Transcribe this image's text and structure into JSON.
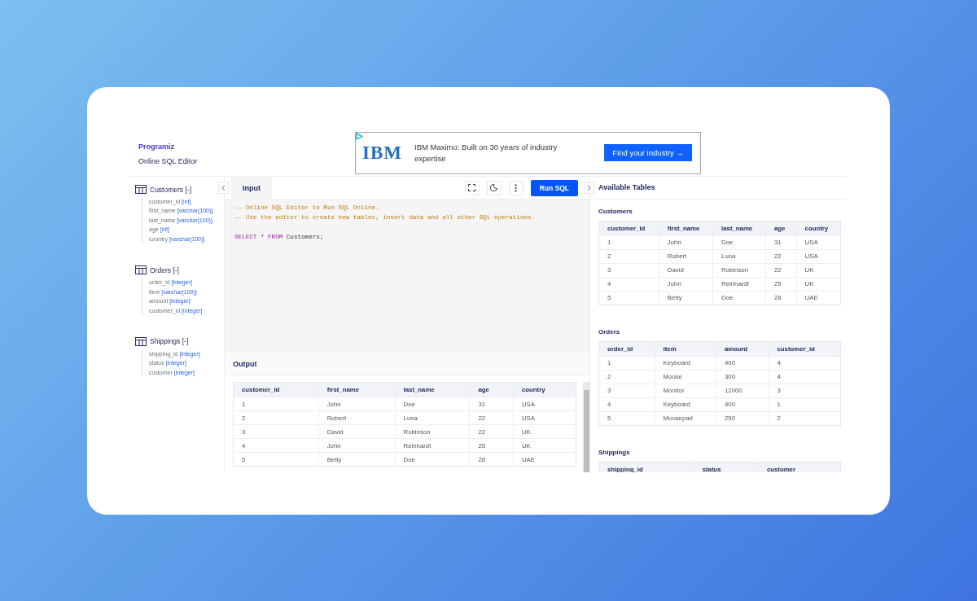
{
  "header": {
    "logo": "Programiz",
    "subtitle": "Online SQL Editor"
  },
  "ad": {
    "brand": "IBM",
    "text": "IBM Maximo: Built on 30 years of industry expertise",
    "button": "Find your industry →"
  },
  "schema": [
    {
      "name": "Customers",
      "toggle": "[-]",
      "columns": [
        {
          "name": "customer_id",
          "type": "[int]"
        },
        {
          "name": "first_name",
          "type": "[varchar(100)]"
        },
        {
          "name": "last_name",
          "type": "[varchar(100)]"
        },
        {
          "name": "age",
          "type": "[int]"
        },
        {
          "name": "country",
          "type": "[varchar(100)]"
        }
      ]
    },
    {
      "name": "Orders",
      "toggle": "[-]",
      "columns": [
        {
          "name": "order_id",
          "type": "[integer]"
        },
        {
          "name": "item",
          "type": "[varchar(100)]"
        },
        {
          "name": "amount",
          "type": "[integer]"
        },
        {
          "name": "customer_id",
          "type": "[integer]"
        }
      ]
    },
    {
      "name": "Shippings",
      "toggle": "[-]",
      "columns": [
        {
          "name": "shipping_id",
          "type": "[integer]"
        },
        {
          "name": "status",
          "type": "[integer]"
        },
        {
          "name": "customer",
          "type": "[integer]"
        }
      ]
    }
  ],
  "editor": {
    "tab": "Input",
    "run_button": "Run SQL",
    "lines": [
      {
        "kind": "comment",
        "text": "-- Online SQL Editor to Run SQL Online."
      },
      {
        "kind": "comment",
        "text": "-- Use the editor to create new tables, insert data and all other SQL operations."
      },
      {
        "kind": "blank"
      },
      {
        "kind": "code",
        "tokens": [
          {
            "kind": "keyword",
            "text": "SELECT"
          },
          {
            "kind": "plain",
            "text": " * "
          },
          {
            "kind": "keyword",
            "text": "FROM"
          },
          {
            "kind": "plain",
            "text": " Customers;"
          }
        ]
      }
    ]
  },
  "output": {
    "title": "Output",
    "columns": [
      "customer_id",
      "first_name",
      "last_name",
      "age",
      "country"
    ],
    "rows": [
      [
        "1",
        "John",
        "Doe",
        "31",
        "USA"
      ],
      [
        "2",
        "Robert",
        "Luna",
        "22",
        "USA"
      ],
      [
        "3",
        "David",
        "Robinson",
        "22",
        "UK"
      ],
      [
        "4",
        "John",
        "Reinhardt",
        "25",
        "UK"
      ],
      [
        "5",
        "Betty",
        "Doe",
        "28",
        "UAE"
      ]
    ]
  },
  "available": {
    "title": "Available Tables",
    "tables": [
      {
        "name": "Customers",
        "columns": [
          "customer_id",
          "first_name",
          "last_name",
          "age",
          "country"
        ],
        "rows": [
          [
            "1",
            "John",
            "Doe",
            "31",
            "USA"
          ],
          [
            "2",
            "Robert",
            "Luna",
            "22",
            "USA"
          ],
          [
            "3",
            "David",
            "Robinson",
            "22",
            "UK"
          ],
          [
            "4",
            "John",
            "Reinhardt",
            "25",
            "UK"
          ],
          [
            "5",
            "Betty",
            "Doe",
            "28",
            "UAE"
          ]
        ]
      },
      {
        "name": "Orders",
        "columns": [
          "order_id",
          "item",
          "amount",
          "customer_id"
        ],
        "rows": [
          [
            "1",
            "Keyboard",
            "400",
            "4"
          ],
          [
            "2",
            "Mouse",
            "300",
            "4"
          ],
          [
            "3",
            "Monitor",
            "12000",
            "3"
          ],
          [
            "4",
            "Keyboard",
            "400",
            "1"
          ],
          [
            "5",
            "Mousepad",
            "250",
            "2"
          ]
        ]
      },
      {
        "name": "Shippings",
        "columns": [
          "shipping_id",
          "status",
          "customer"
        ]
      }
    ]
  }
}
